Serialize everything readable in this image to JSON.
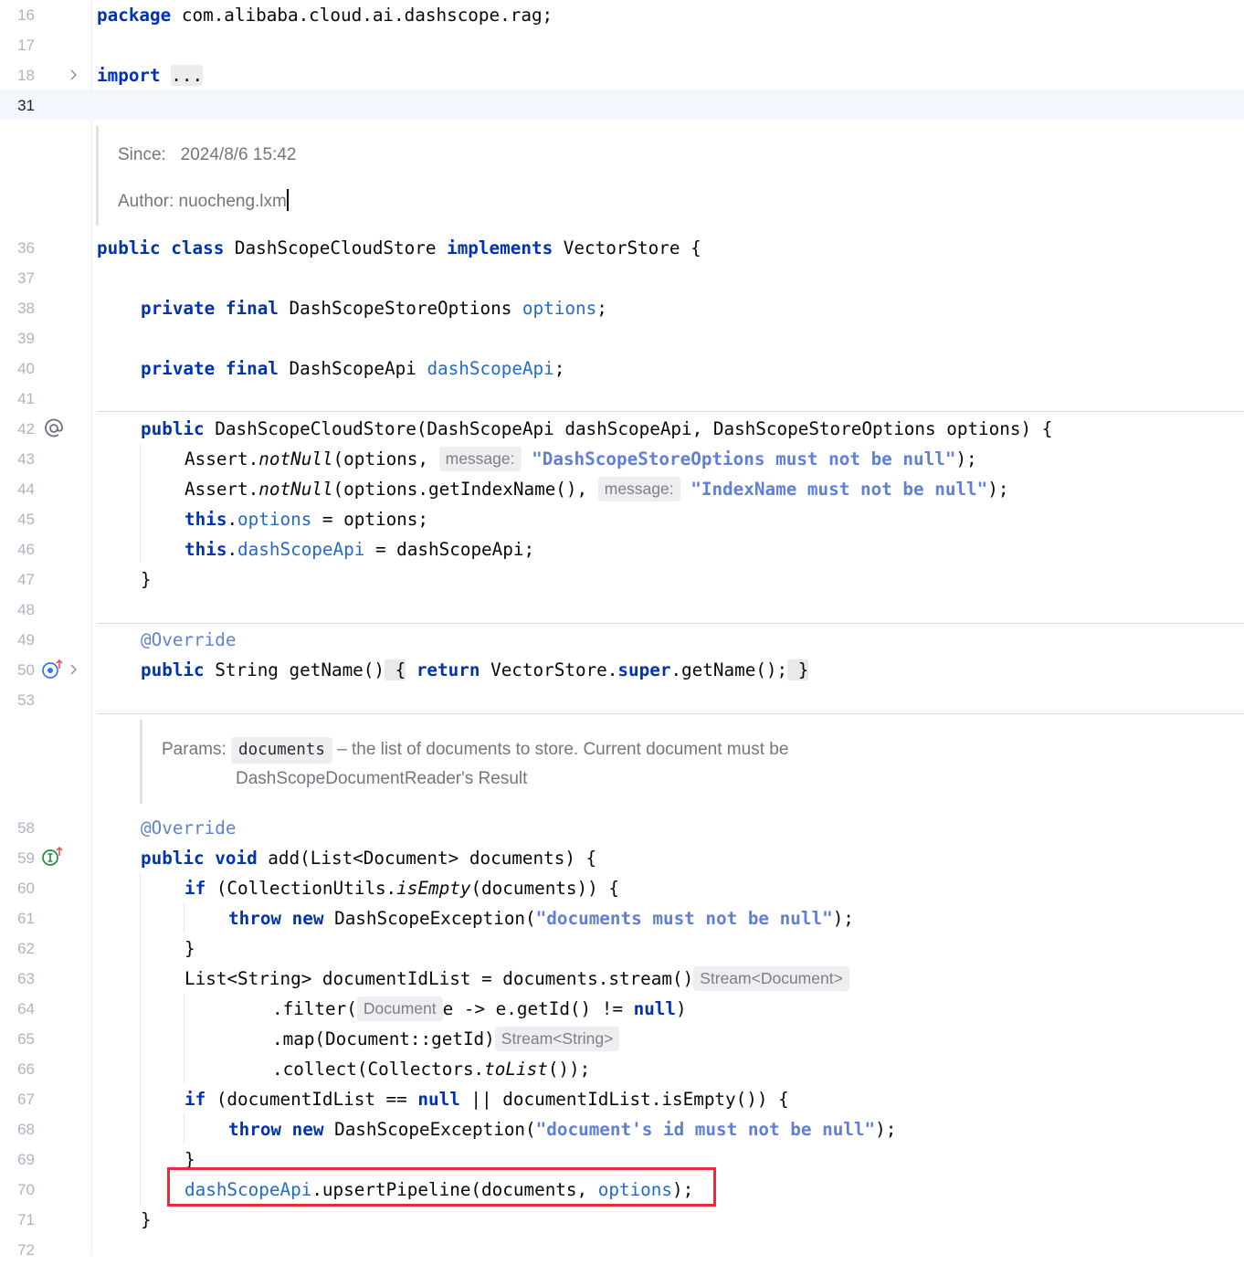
{
  "lines": {
    "l16": {
      "num": "16",
      "kw": "package",
      "rest": " com.alibaba.cloud.ai.dashscope.rag;"
    },
    "l17": {
      "num": "17"
    },
    "l18": {
      "num": "18",
      "kw": "import",
      "fold": "..."
    },
    "l31": {
      "num": "31"
    },
    "l36": {
      "num": "36",
      "kw1": "public",
      "kw2": "class",
      "name": " DashScopeCloudStore ",
      "kw3": "implements",
      "rest": " VectorStore {"
    },
    "l37": {
      "num": "37"
    },
    "l38": {
      "num": "38",
      "kw1": "private",
      "kw2": "final",
      "type": " DashScopeStoreOptions ",
      "field": "options",
      "end": ";"
    },
    "l39": {
      "num": "39"
    },
    "l40": {
      "num": "40",
      "kw1": "private",
      "kw2": "final",
      "type": " DashScopeApi ",
      "field": "dashScopeApi",
      "end": ";"
    },
    "l41": {
      "num": "41"
    },
    "l42": {
      "num": "42",
      "kw": "public",
      "rest": " DashScopeCloudStore(DashScopeApi dashScopeApi, DashScopeStoreOptions options) {"
    },
    "l43": {
      "num": "43",
      "pre": "Assert.",
      "method": "notNull",
      "args": "(options, ",
      "hint": "message:",
      "str": "\"DashScopeStoreOptions must not be null\"",
      "end": ");"
    },
    "l44": {
      "num": "44",
      "pre": "Assert.",
      "method": "notNull",
      "args": "(options.getIndexName(), ",
      "hint": "message:",
      "str": "\"IndexName must not be null\"",
      "end": ");"
    },
    "l45": {
      "num": "45",
      "kw": "this",
      "dot": ".",
      "field": "options",
      "rest": " = options;"
    },
    "l46": {
      "num": "46",
      "kw": "this",
      "dot": ".",
      "field": "dashScopeApi",
      "rest": " = dashScopeApi;"
    },
    "l47": {
      "num": "47",
      "text": "}"
    },
    "l48": {
      "num": "48"
    },
    "l49": {
      "num": "49",
      "ann": "@Override"
    },
    "l50": {
      "num": "50",
      "kw": "public",
      "mid": " String getName()",
      "sp": " ",
      "ob": "{",
      "sp2": " ",
      "kw2": "return",
      "rest": " VectorStore.",
      "kw3": "super",
      "rest2": ".getName();",
      "cb": "}"
    },
    "l53": {
      "num": "53"
    },
    "l58": {
      "num": "58",
      "ann": "@Override"
    },
    "l59": {
      "num": "59",
      "kw1": "public",
      "kw2": "void",
      "rest": " add(List<Document> documents) {"
    },
    "l60": {
      "num": "60",
      "kw": "if",
      "pre": " (CollectionUtils.",
      "method": "isEmpty",
      "rest": "(documents)) {"
    },
    "l61": {
      "num": "61",
      "kw1": "throw",
      "kw2": "new",
      "rest": " DashScopeException(",
      "str": "\"documents must not be null\"",
      "end": ");"
    },
    "l62": {
      "num": "62",
      "text": "}"
    },
    "l63": {
      "num": "63",
      "text": "List<String> documentIdList = documents.stream()",
      "hint": "Stream<Document>"
    },
    "l64": {
      "num": "64",
      "pre": ".filter(",
      "hint": "Document",
      "mid": "e -> e.getId() != ",
      "kw": "null",
      "end": ")"
    },
    "l65": {
      "num": "65",
      "text": ".map(Document::getId)",
      "hint": "Stream<String>"
    },
    "l66": {
      "num": "66",
      "pre": ".collect(Collectors.",
      "method": "toList",
      "end": "());"
    },
    "l67": {
      "num": "67",
      "kw": "if",
      "pre": " (documentIdList == ",
      "kw2": "null",
      "rest": " || documentIdList.isEmpty()) {"
    },
    "l68": {
      "num": "68",
      "kw1": "throw",
      "kw2": "new",
      "rest": " DashScopeException(",
      "str": "\"document's id must not be null\"",
      "end": ");"
    },
    "l69": {
      "num": "69",
      "text": "}"
    },
    "l70": {
      "num": "70",
      "field": "dashScopeApi",
      "mid": ".upsertPipeline(documents, ",
      "field2": "options",
      "end": ");"
    },
    "l71": {
      "num": "71",
      "text": "}"
    },
    "l72": {
      "num": "72"
    }
  },
  "doc1": {
    "since_label": "Since:",
    "since_value": "2024/8/6 15:42",
    "author_label": "Author:",
    "author_value": "nuocheng.lxm"
  },
  "doc2": {
    "params_label": "Params:",
    "param_name": "documents",
    "desc1": "– the list of documents to store. Current document must be",
    "desc2": "DashScopeDocumentReader's Result"
  },
  "icons": {
    "fold_arrow": "chevron-right-icon",
    "override_at": "implementation-at-icon",
    "overrides_up": "override-method-icon",
    "implements_up": "implements-method-icon"
  },
  "colors": {
    "keyword": "#0033b3",
    "field": "#236acd",
    "string": "#5f7fd8",
    "annotation": "#5f82cf",
    "highlight_box": "#ea2a36"
  }
}
